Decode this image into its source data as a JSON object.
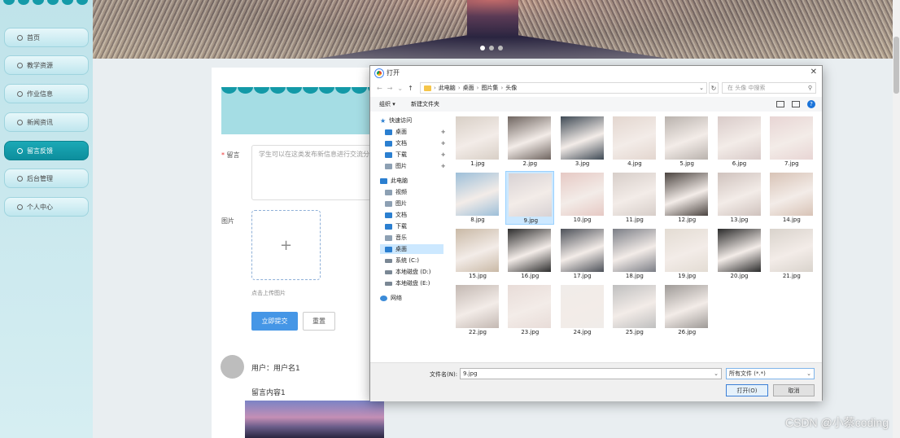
{
  "sidebar": {
    "items": [
      {
        "label": "首页",
        "active": false
      },
      {
        "label": "教学资源",
        "active": false
      },
      {
        "label": "作业信息",
        "active": false
      },
      {
        "label": "新闻资讯",
        "active": false
      },
      {
        "label": "留言反馈",
        "active": true
      },
      {
        "label": "后台管理",
        "active": false
      },
      {
        "label": "个人中心",
        "active": false
      }
    ]
  },
  "form": {
    "message_label": "留言",
    "required_mark": "*",
    "message_placeholder": "学生可以在这类发布新信息进行交流分",
    "image_label": "图片",
    "upload_tip": "点击上传图片",
    "plus": "+",
    "submit_label": "立即提交",
    "reset_label": "重置"
  },
  "comments": [
    {
      "user": "用户：用户名1",
      "content": "留言内容1"
    }
  ],
  "dialog": {
    "title": "打开",
    "close": "✕",
    "breadcrumb": [
      "此电脑",
      "桌面",
      "图片集",
      "头像"
    ],
    "search_placeholder": "在 头像 中搜索",
    "organize_label": "组织 ▾",
    "new_folder_label": "新建文件夹",
    "help": "?",
    "tree": [
      {
        "label": "快速访问",
        "icon": "star-icon",
        "head": true
      },
      {
        "label": "桌面",
        "icon": "desktop-icon",
        "pinned": true
      },
      {
        "label": "文档",
        "icon": "document-icon",
        "pinned": true
      },
      {
        "label": "下载",
        "icon": "download-icon",
        "pinned": true
      },
      {
        "label": "图片",
        "icon": "picture-icon",
        "pinned": true
      },
      {
        "label": "此电脑",
        "icon": "computer-icon",
        "head": true
      },
      {
        "label": "视频",
        "icon": "video-icon"
      },
      {
        "label": "图片",
        "icon": "picture-icon"
      },
      {
        "label": "文档",
        "icon": "document-icon"
      },
      {
        "label": "下载",
        "icon": "download-icon"
      },
      {
        "label": "音乐",
        "icon": "music-icon"
      },
      {
        "label": "桌面",
        "icon": "desktop-icon",
        "selected": true
      },
      {
        "label": "系统 (C:)",
        "icon": "drive-icon"
      },
      {
        "label": "本地磁盘 (D:)",
        "icon": "drive-icon"
      },
      {
        "label": "本地磁盘 (E:)",
        "icon": "drive-icon"
      },
      {
        "label": "网络",
        "icon": "network-icon",
        "head": true
      }
    ],
    "files": [
      {
        "name": "1.jpg",
        "color": "#d8cfc6"
      },
      {
        "name": "2.jpg",
        "color": "#6f6560"
      },
      {
        "name": "3.jpg",
        "color": "#3f4a55"
      },
      {
        "name": "4.jpg",
        "color": "#e3d6cf"
      },
      {
        "name": "5.jpg",
        "color": "#b9b2ad"
      },
      {
        "name": "6.jpg",
        "color": "#d9cbc9"
      },
      {
        "name": "7.jpg",
        "color": "#e8d5d4"
      },
      {
        "name": "8.jpg",
        "color": "#9dbfd9"
      },
      {
        "name": "9.jpg",
        "color": "#d8d2d4",
        "selected": true
      },
      {
        "name": "10.jpg",
        "color": "#e6c9c4"
      },
      {
        "name": "11.jpg",
        "color": "#d7cec9"
      },
      {
        "name": "12.jpg",
        "color": "#4b4440"
      },
      {
        "name": "13.jpg",
        "color": "#cfc2bd"
      },
      {
        "name": "14.jpg",
        "color": "#d8c3b6"
      },
      {
        "name": "15.jpg",
        "color": "#c9b9a6"
      },
      {
        "name": "16.jpg",
        "color": "#2e2e2e"
      },
      {
        "name": "17.jpg",
        "color": "#4d5159"
      },
      {
        "name": "18.jpg",
        "color": "#7b7e86"
      },
      {
        "name": "19.jpg",
        "color": "#e3dcd3"
      },
      {
        "name": "20.jpg",
        "color": "#2b2b2b"
      },
      {
        "name": "21.jpg",
        "color": "#d9d3cc"
      },
      {
        "name": "22.jpg",
        "color": "#c3b8b2"
      },
      {
        "name": "23.jpg",
        "color": "#e8dcd8"
      },
      {
        "name": "24.jpg",
        "color": "#f0ece9"
      },
      {
        "name": "25.jpg",
        "color": "#bfbfbf"
      },
      {
        "name": "26.jpg",
        "color": "#9e9a97"
      }
    ],
    "filename_label": "文件名(N):",
    "filename_value": "9.jpg",
    "filetype_value": "所有文件 (*.*)",
    "open_label": "打开(O)",
    "cancel_label": "取消"
  },
  "watermark": "CSDN @小蔡coding",
  "colors": {
    "accent": "#149aa8",
    "primary_button": "#4596e6"
  }
}
